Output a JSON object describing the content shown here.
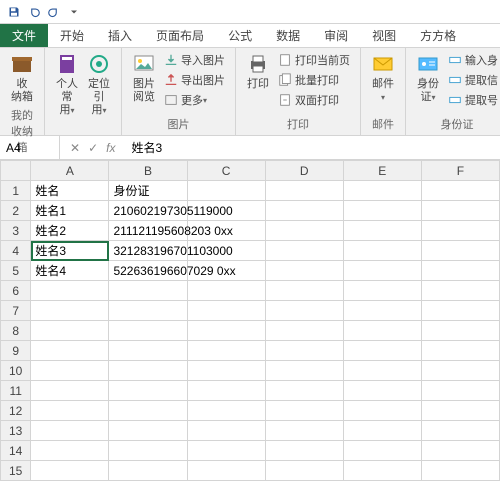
{
  "qat": [
    "save",
    "undo",
    "redo",
    "dropdown"
  ],
  "tabs": {
    "file": "文件",
    "items": [
      "开始",
      "插入",
      "页面布局",
      "公式",
      "数据",
      "审阅",
      "视图",
      "方方格"
    ]
  },
  "ribbon": {
    "group1": {
      "btn1": "收\n纳箱",
      "label": "我的收纳箱"
    },
    "group2": {
      "btn1": "个人常\n用",
      "btn2": "定位引\n用"
    },
    "group3": {
      "btn1": "图片\n阅览",
      "s1": "导入图片",
      "s2": "导出图片",
      "s3": "更多",
      "label": "图片"
    },
    "group4": {
      "btn1": "打印",
      "s1": "打印当前页",
      "s2": "批量打印",
      "s3": "双面打印",
      "label": "打印"
    },
    "group5": {
      "btn1": "邮件",
      "label": "邮件"
    },
    "group6": {
      "btn1": "身份\n证",
      "s1": "输入身",
      "s2": "提取信",
      "s3": "提取号",
      "label": "身份证"
    }
  },
  "namebox": "A4",
  "formula": "姓名3",
  "headers": [
    "A",
    "B",
    "C",
    "D",
    "E",
    "F"
  ],
  "rows": [
    {
      "n": "1",
      "a": "姓名",
      "b": "身份证"
    },
    {
      "n": "2",
      "a": "姓名1",
      "b": "210602197305119000"
    },
    {
      "n": "3",
      "a": "姓名2",
      "b": "211121195608203 0xx"
    },
    {
      "n": "4",
      "a": "姓名3",
      "b": "321283196701103000"
    },
    {
      "n": "5",
      "a": "姓名4",
      "b": "522636196607029 0xx"
    },
    {
      "n": "6"
    },
    {
      "n": "7"
    },
    {
      "n": "8"
    },
    {
      "n": "9"
    },
    {
      "n": "10"
    },
    {
      "n": "11"
    },
    {
      "n": "12"
    },
    {
      "n": "13"
    },
    {
      "n": "14"
    },
    {
      "n": "15"
    }
  ],
  "selected": {
    "row": 4,
    "col": "A"
  }
}
